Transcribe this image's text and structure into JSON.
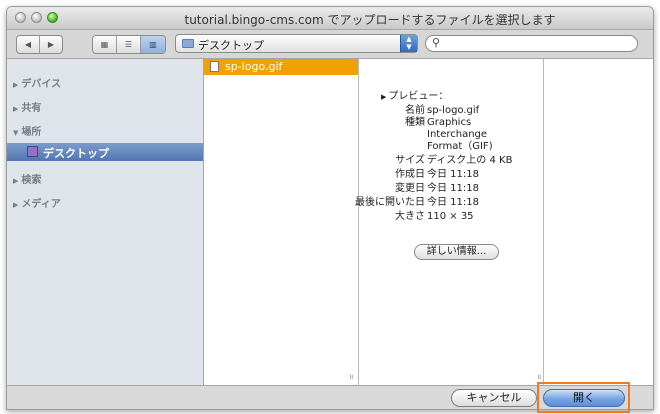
{
  "window": {
    "title": "tutorial.bingo-cms.com でアップロードするファイルを選択します"
  },
  "toolbar": {
    "back_icon": "back-arrow-icon",
    "forward_icon": "forward-arrow-icon",
    "view_modes": [
      "icon-view",
      "list-view",
      "column-view"
    ],
    "active_view": "column-view",
    "location": "デスクトップ",
    "search_value": ""
  },
  "sidebar": {
    "sections": [
      {
        "label": "デバイス"
      },
      {
        "label": "共有"
      },
      {
        "label": "場所",
        "items": [
          {
            "label": "デスクトップ",
            "selected": true
          }
        ]
      },
      {
        "label": "検索"
      },
      {
        "label": "メディア"
      }
    ]
  },
  "files": [
    {
      "name": "sp-logo.gif",
      "selected": true
    }
  ],
  "preview": {
    "label": "プレビュー：",
    "fields": [
      {
        "key": "名前",
        "value": "sp-logo.gif"
      },
      {
        "key": "種類",
        "value": "Graphics"
      },
      {
        "key": "",
        "value": "Interchange"
      },
      {
        "key": "",
        "value": "Format（GIF)"
      },
      {
        "key": "サイズ",
        "value": "ディスク上の 4 KB"
      },
      {
        "key": "作成日",
        "value": "今日 11:18"
      },
      {
        "key": "変更日",
        "value": "今日 11:18"
      },
      {
        "key": "最後に開いた日",
        "value": "今日 11:18"
      },
      {
        "key": "大きさ",
        "value": "110 × 35"
      }
    ],
    "more_info_button": "詳しい情報..."
  },
  "buttons": {
    "cancel": "キャンセル",
    "open": "開く"
  },
  "colors": {
    "selection_orange": "#f0a300",
    "sidebar_selection": "#5176b2",
    "highlight_box": "#f07a1d"
  }
}
